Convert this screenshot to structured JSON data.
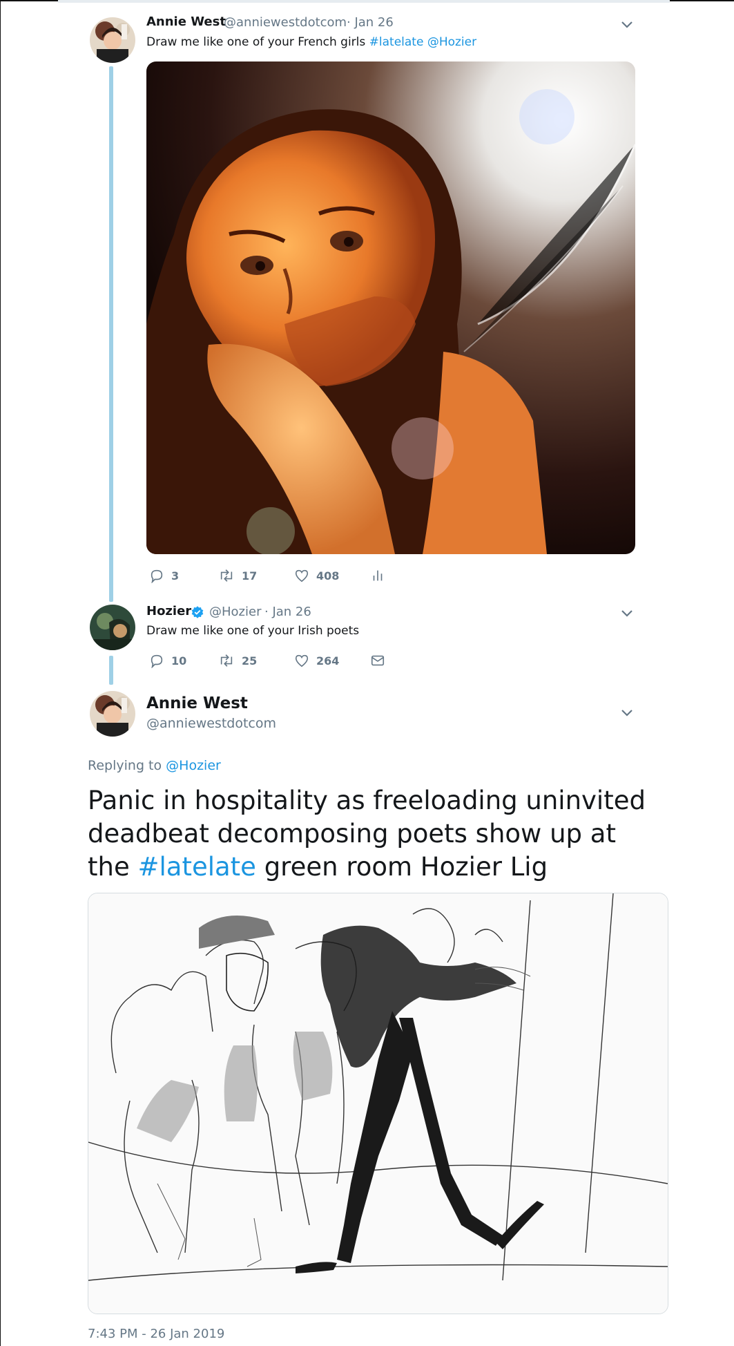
{
  "tweet1": {
    "name": "Annie West",
    "handle": "@anniewestdotcom",
    "date": "· Jan 26",
    "text_plain": "Draw me like one of your French girls ",
    "hashtag": "#latelate",
    "mention": "@Hozier",
    "replies": "3",
    "retweets": "17",
    "likes": "408"
  },
  "tweet2": {
    "name": "Hozier",
    "handle": "@Hozier",
    "date": "· Jan 26",
    "text": "Draw me like one of your Irish poets",
    "replies": "10",
    "retweets": "25",
    "likes": "264"
  },
  "tweet3": {
    "name": "Annie West",
    "handle": "@anniewestdotcom",
    "replying_prefix": "Replying to ",
    "replying_to": "@Hozier",
    "text_part1": "Panic in hospitality as freeloading uninvited deadbeat decomposing poets show up at the ",
    "hashtag": "#latelate",
    "text_part2": " green room Hozier Lig",
    "timestamp": "7:43 PM - 26 Jan 2019"
  },
  "colors": {
    "link": "#1b95e0",
    "thread_line": "#9fd0e6",
    "muted": "#657786"
  },
  "icons": [
    "chevron-down-icon",
    "reply-icon",
    "retweet-icon",
    "like-icon",
    "analytics-icon",
    "direct-message-icon",
    "verified-badge-icon"
  ]
}
